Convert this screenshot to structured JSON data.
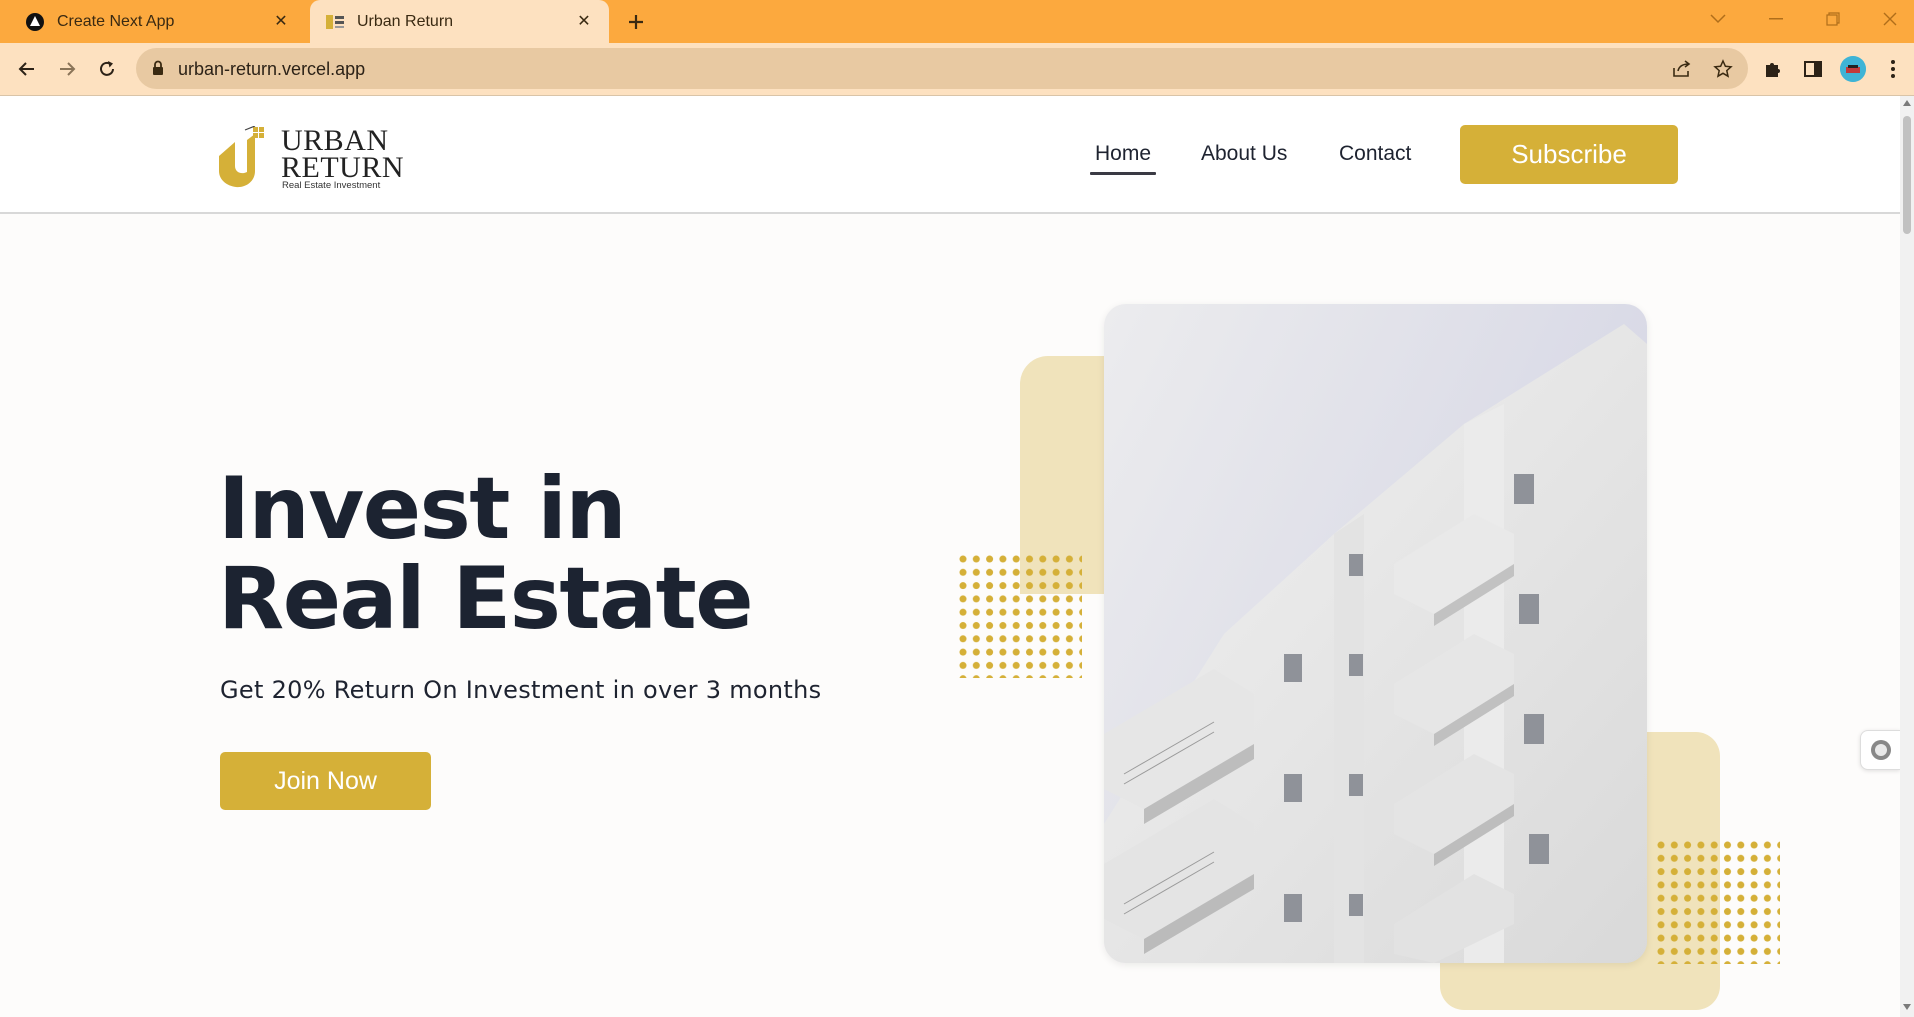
{
  "browser": {
    "tabs": [
      {
        "title": "Create Next App",
        "active": false
      },
      {
        "title": "Urban Return",
        "active": true
      }
    ],
    "url": "urban-return.vercel.app"
  },
  "site": {
    "logo": {
      "line1": "URBAN",
      "line2": "RETURN",
      "tagline": "Real Estate Investment"
    },
    "nav": {
      "home": "Home",
      "about": "About Us",
      "contact": "Contact",
      "subscribe": "Subscribe"
    },
    "hero": {
      "title_line1": "Invest in",
      "title_line2": "Real Estate",
      "subtitle": "Get 20% Return On Investment in over 3 months",
      "cta": "Join Now"
    }
  },
  "colors": {
    "accent": "#d5b038",
    "accent_light": "#f0e3bb",
    "heading": "#1c2331",
    "tabbar": "#fca93e"
  }
}
